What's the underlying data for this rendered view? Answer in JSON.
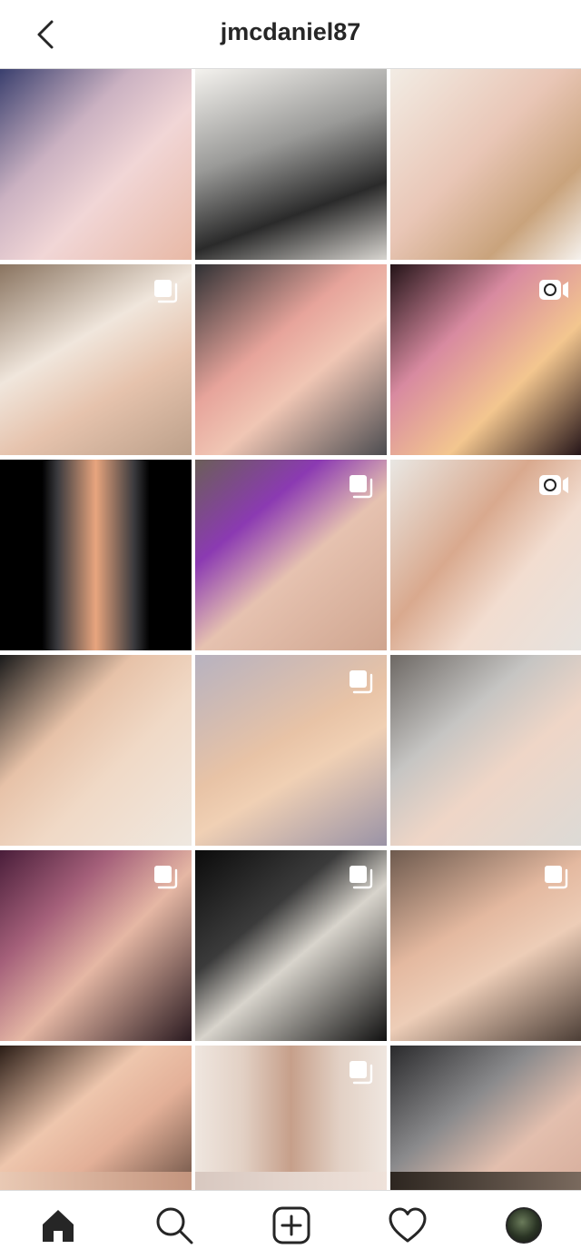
{
  "header": {
    "title": "jmcdaniel87"
  },
  "colors": {
    "text": "#262626",
    "divider": "#dbdbdb",
    "background": "#ffffff"
  },
  "grid": {
    "rows": [
      {
        "cells": [
          {
            "badge": "none",
            "bg": "linear-gradient(135deg,#3a3f6e 0%,#cbb2c2 35%,#f1d6d6 60%,#e8b9a6 100%)"
          },
          {
            "badge": "none",
            "bg": "linear-gradient(160deg,#f4f2ee 0%,#9a9a98 40%,#2a2a2a 70%,#d8d5d0 100%)"
          },
          {
            "badge": "none",
            "bg": "linear-gradient(135deg,#f2ece4 0%,#e9c6b6 45%,#c9a37c 75%,#f6f2ee 100%)"
          }
        ]
      },
      {
        "cells": [
          {
            "badge": "carousel",
            "bg": "linear-gradient(150deg,#8a7460 0%,#f0e6dc 40%,#e6c3ad 65%,#bca08a 100%)"
          },
          {
            "badge": "none",
            "bg": "linear-gradient(140deg,#2f3033 0%,#e7a49b 40%,#f0c6b4 60%,#4c4c50 100%)"
          },
          {
            "badge": "video",
            "bg": "linear-gradient(135deg,#241418 0%,#d88aa0 35%,#f3c68f 65%,#241418 100%)"
          }
        ]
      },
      {
        "cells": [
          {
            "badge": "none",
            "bg": "linear-gradient(90deg,#000 0%,#000 22%,#3a3a3e 30%,#e8a57e 50%,#3a3a3e 70%,#000 78%,#000 100%)"
          },
          {
            "badge": "carousel",
            "bg": "linear-gradient(140deg,#6b5f58 0%,#8b3ab2 30%,#e6c2b0 55%,#cfa58f 100%)"
          },
          {
            "badge": "video",
            "bg": "linear-gradient(130deg,#e9e7e3 0%,#d9a98e 40%,#f2ddd0 65%,#e6e2de 100%)"
          }
        ]
      },
      {
        "cells": [
          {
            "badge": "none",
            "bg": "linear-gradient(135deg,#1a1a1a 0%,#e7c2a8 35%,#f0d9c6 60%,#efe8e0 100%)"
          },
          {
            "badge": "carousel",
            "bg": "linear-gradient(150deg,#b7b2c0 0%,#e8c3a6 45%,#f0d0b4 60%,#9a93a6 100%)"
          },
          {
            "badge": "none",
            "bg": "linear-gradient(140deg,#6d6864 0%,#c6c5c3 35%,#efd6c7 60%,#dcdad6 100%)"
          }
        ]
      },
      {
        "cells": [
          {
            "badge": "carousel",
            "bg": "linear-gradient(135deg,#4a1e3a 0%,#a5607a 30%,#e5b7a4 55%,#2a1a20 100%)"
          },
          {
            "badge": "carousel",
            "bg": "linear-gradient(140deg,#0b0b0b 0%,#3b3b3b 35%,#d8d4cc 55%,#111 100%)"
          },
          {
            "badge": "carousel",
            "bg": "linear-gradient(150deg,#6e5a4e 0%,#e4b9a0 40%,#edcdb7 60%,#4c3e36 100%)"
          }
        ]
      },
      {
        "cells": [
          {
            "badge": "none",
            "bg": "linear-gradient(140deg,#2b1d16 0%,#eec6ad 35%,#e3b098 55%,#3a2a22 100%)"
          },
          {
            "badge": "carousel",
            "bg": "linear-gradient(90deg,#efe6df 0%,#e2d0c4 25%,#c69f8a 50%,#e2d0c4 75%,#efe6df 100%)"
          },
          {
            "badge": "none",
            "bg": "linear-gradient(140deg,#2a2a2c 0%,#8a8a8c 35%,#e3bfae 60%,#d1a593 100%)"
          }
        ]
      }
    ]
  },
  "tabs": [
    {
      "name": "home",
      "icon": "home-icon"
    },
    {
      "name": "search",
      "icon": "search-icon"
    },
    {
      "name": "new-post",
      "icon": "plus-square-icon"
    },
    {
      "name": "activity",
      "icon": "heart-icon"
    },
    {
      "name": "profile",
      "icon": "avatar"
    }
  ]
}
